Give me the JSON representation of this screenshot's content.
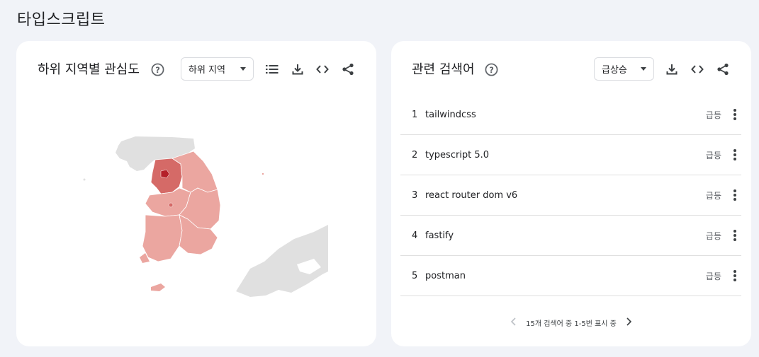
{
  "page": {
    "title": "타입스크립트"
  },
  "subregion": {
    "title": "하위 지역별 관심도",
    "help_icon": "question-circle-icon",
    "dropdown_value": "하위 지역",
    "tools": [
      "list-icon",
      "download-icon",
      "embed-code-icon",
      "share-icon"
    ],
    "map": {
      "colors": {
        "low": "#eba6a0",
        "mid": "#d56a67",
        "high": "#b52029",
        "none": "#e0e0e0"
      }
    }
  },
  "related": {
    "title": "관련 검색어",
    "help_icon": "question-circle-icon",
    "dropdown_value": "급상승",
    "tools": [
      "download-icon",
      "embed-code-icon",
      "share-icon"
    ],
    "items": [
      {
        "rank": "1",
        "term": "tailwindcss",
        "badge": "급등"
      },
      {
        "rank": "2",
        "term": "typescript 5.0",
        "badge": "급등"
      },
      {
        "rank": "3",
        "term": "react router dom v6",
        "badge": "급등"
      },
      {
        "rank": "4",
        "term": "fastify",
        "badge": "급등"
      },
      {
        "rank": "5",
        "term": "postman",
        "badge": "급등"
      }
    ],
    "pagination": {
      "label": "15개 검색어 중 1-5번 표시 중"
    }
  }
}
